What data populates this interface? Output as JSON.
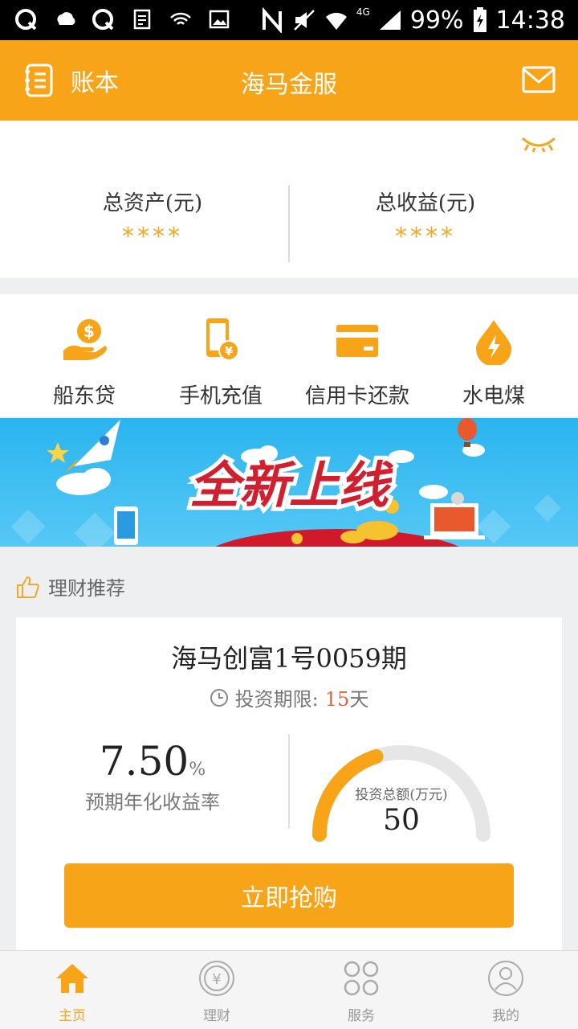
{
  "status_bar": {
    "network": "4G",
    "battery": "99%",
    "time": "14:38"
  },
  "header": {
    "left_label": "账本",
    "title": "海马金服"
  },
  "assets": {
    "total_assets_label": "总资产(元)",
    "total_assets_value": "****",
    "total_income_label": "总收益(元)",
    "total_income_value": "****"
  },
  "services": [
    {
      "label": "船东贷",
      "icon": "loan-icon"
    },
    {
      "label": "手机充值",
      "icon": "phone-recharge-icon"
    },
    {
      "label": "信用卡还款",
      "icon": "credit-card-icon"
    },
    {
      "label": "水电煤",
      "icon": "utilities-icon"
    }
  ],
  "banner": {
    "title": "全新上线"
  },
  "recommend": {
    "section_title": "理财推荐",
    "product": {
      "name": "海马创富1号0059期",
      "term_label": "投资期限:",
      "term_value": "15",
      "term_unit": "天",
      "rate_value": "7.50",
      "rate_unit": "%",
      "rate_label": "预期年化收益率",
      "amount_label": "投资总额(万元)",
      "amount_value": "50",
      "progress": 0.4,
      "button_label": "立即抢购"
    }
  },
  "bottom_nav": [
    {
      "label": "主页",
      "icon": "home-icon",
      "active": true
    },
    {
      "label": "理财",
      "icon": "yen-icon",
      "active": false
    },
    {
      "label": "服务",
      "icon": "grid-icon",
      "active": false
    },
    {
      "label": "我的",
      "icon": "user-icon",
      "active": false
    }
  ],
  "colors": {
    "accent": "#f8a418",
    "term_highlight": "#e8643c",
    "banner_sky": "#29b6f6"
  }
}
